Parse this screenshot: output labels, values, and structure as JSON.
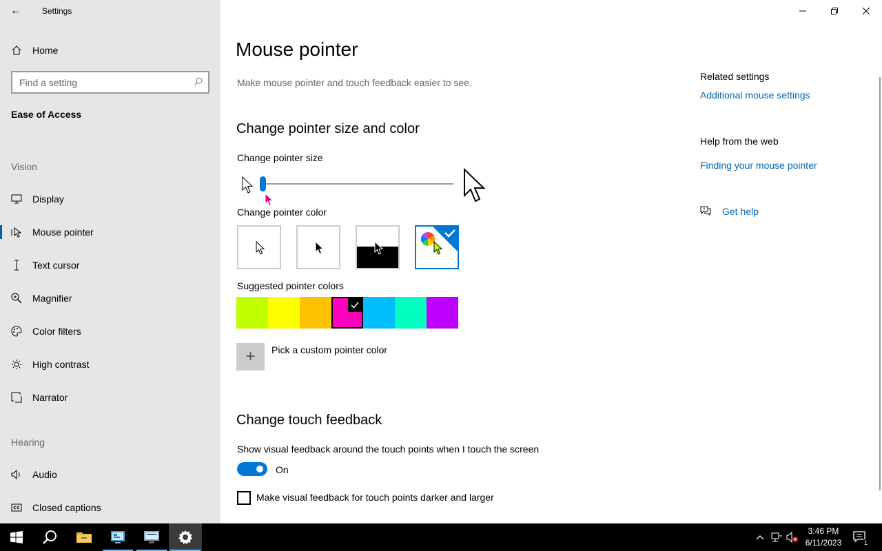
{
  "window": {
    "title": "Settings",
    "back_glyph": "←",
    "minimize_glyph": "—",
    "restore_glyph": "❐",
    "close_glyph": "✕"
  },
  "sidebar": {
    "home_label": "Home",
    "search_placeholder": "Find a setting",
    "section_title": "Ease of Access",
    "groups": {
      "vision": "Vision",
      "hearing": "Hearing"
    },
    "items": [
      {
        "label": "Display",
        "icon": "display-icon"
      },
      {
        "label": "Mouse pointer",
        "icon": "mouse-pointer-icon",
        "selected": true
      },
      {
        "label": "Text cursor",
        "icon": "text-cursor-icon"
      },
      {
        "label": "Magnifier",
        "icon": "magnifier-icon"
      },
      {
        "label": "Color filters",
        "icon": "color-filters-icon"
      },
      {
        "label": "High contrast",
        "icon": "high-contrast-icon"
      },
      {
        "label": "Narrator",
        "icon": "narrator-icon"
      },
      {
        "label": "Audio",
        "icon": "audio-icon"
      },
      {
        "label": "Closed captions",
        "icon": "closed-captions-icon"
      }
    ]
  },
  "main": {
    "title": "Mouse pointer",
    "description": "Make mouse pointer and touch feedback easier to see.",
    "section1": {
      "heading": "Change pointer size and color",
      "size_label": "Change pointer size",
      "size_value_fraction": 0.0,
      "color_label": "Change pointer color",
      "color_options": [
        "white",
        "black",
        "inverted",
        "custom"
      ],
      "selected_color_option": "custom",
      "suggested_label": "Suggested pointer colors",
      "suggested_colors": [
        "#bfff00",
        "#ffff00",
        "#ffc000",
        "#ff00bf",
        "#00bfff",
        "#00ffbf",
        "#bf00ff"
      ],
      "selected_suggested_index": 3,
      "custom_label": "Pick a custom pointer color",
      "custom_plus": "+"
    },
    "section2": {
      "heading": "Change touch feedback",
      "toggle_label": "Show visual feedback around the touch points when I touch the screen",
      "toggle_state": "On",
      "checkbox_label": "Make visual feedback for touch points darker and larger"
    }
  },
  "related": {
    "heading": "Related settings",
    "link": "Additional mouse settings",
    "help_heading": "Help from the web",
    "help_link": "Finding your mouse pointer",
    "get_help": "Get help"
  },
  "taskbar": {
    "time": "3:46 PM",
    "date": "6/11/2023",
    "notification_count": "1",
    "tray_chevron": "^"
  },
  "colors": {
    "accent": "#0078d7",
    "link": "#0067b8",
    "pointer_magenta": "#e6007e",
    "pointer_lime": "#bfff00"
  }
}
